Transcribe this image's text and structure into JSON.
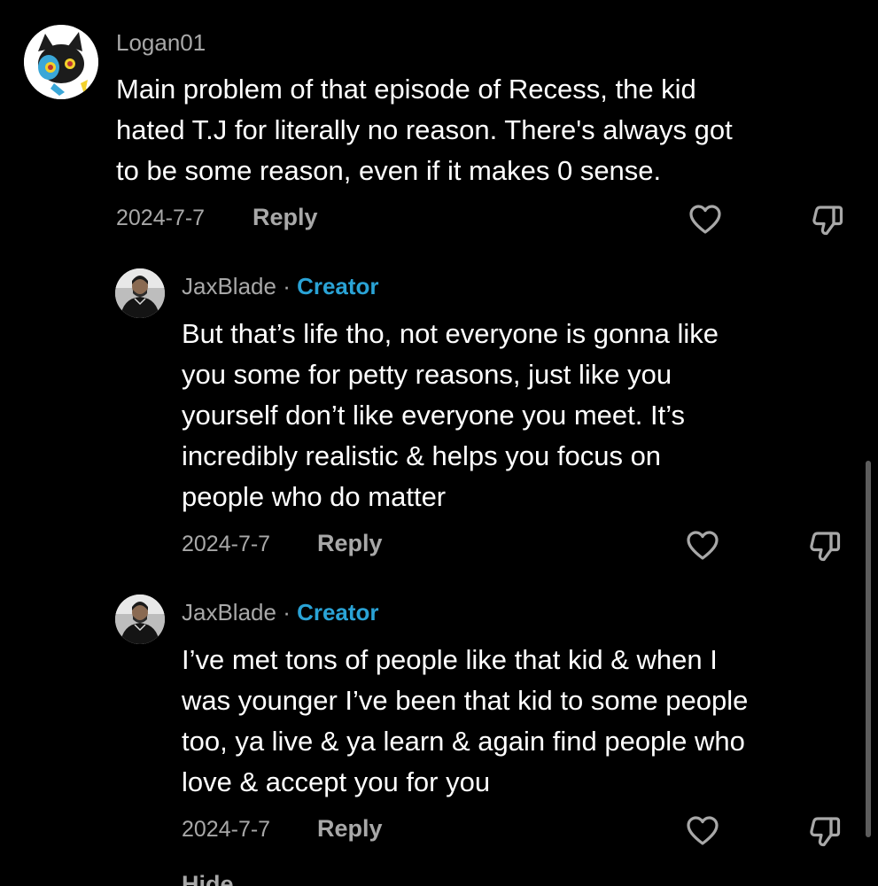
{
  "comments": [
    {
      "username": "Logan01",
      "is_creator": false,
      "text": "Main problem of that episode of Recess, the kid\nhated T.J for literally no reason. There's always got\nto be some reason, even if it makes 0 sense.",
      "date": "2024-7-7",
      "reply_label": "Reply",
      "avatar_icon": "luxio-avatar-icon"
    },
    {
      "username": "JaxBlade",
      "separator": " · ",
      "creator_label": "Creator",
      "is_creator": true,
      "text": "But that’s life tho, not everyone is gonna like\nyou some for petty reasons, just like you\nyourself don’t like everyone you meet. It’s\nincredibly realistic & helps you focus on\npeople who do matter",
      "date": "2024-7-7",
      "reply_label": "Reply",
      "avatar_icon": "person-avatar-icon"
    },
    {
      "username": "JaxBlade",
      "separator": " · ",
      "creator_label": "Creator",
      "is_creator": true,
      "text": "I’ve met tons of people like that kid & when I\nwas younger I’ve been that kid to some people\ntoo, ya live & ya learn & again find people who\nlove & accept you for you",
      "date": "2024-7-7",
      "reply_label": "Reply",
      "avatar_icon": "person-avatar-icon"
    }
  ],
  "hide_label": "Hide",
  "colors": {
    "background": "#000000",
    "muted_text": "#a8a8a8",
    "creator_accent": "#2aa3d6",
    "body_text": "#ffffff"
  }
}
